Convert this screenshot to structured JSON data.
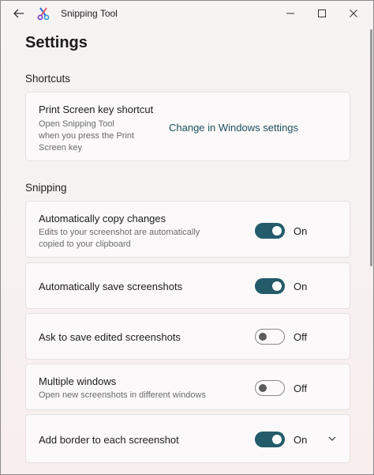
{
  "app": {
    "title": "Snipping Tool"
  },
  "page": {
    "title": "Settings"
  },
  "sections": {
    "shortcuts": "Shortcuts",
    "snipping": "Snipping"
  },
  "shortcut_card": {
    "title": "Print Screen key shortcut",
    "desc_lines": [
      "Open Snipping Tool",
      "when you press the Print",
      "Screen key"
    ],
    "link": "Change in Windows settings"
  },
  "settings": [
    {
      "title": "Automatically copy changes",
      "desc_lines": [
        "Edits to your screenshot are automatically",
        "copied to your clipboard"
      ],
      "state": "On",
      "enabled": true
    },
    {
      "title": "Automatically save screenshots",
      "desc_lines": [],
      "state": "On",
      "enabled": true
    },
    {
      "title": "Ask to save edited screenshots",
      "desc_lines": [],
      "state": "Off",
      "enabled": false
    },
    {
      "title": "Multiple windows",
      "desc_lines": [
        "Open new screenshots in different windows"
      ],
      "state": "Off",
      "enabled": false
    },
    {
      "title": "Add border to each screenshot",
      "desc_lines": [],
      "state": "On",
      "enabled": true
    }
  ],
  "colors": {
    "accent": "#245b6b",
    "link": "#1e4f63"
  }
}
